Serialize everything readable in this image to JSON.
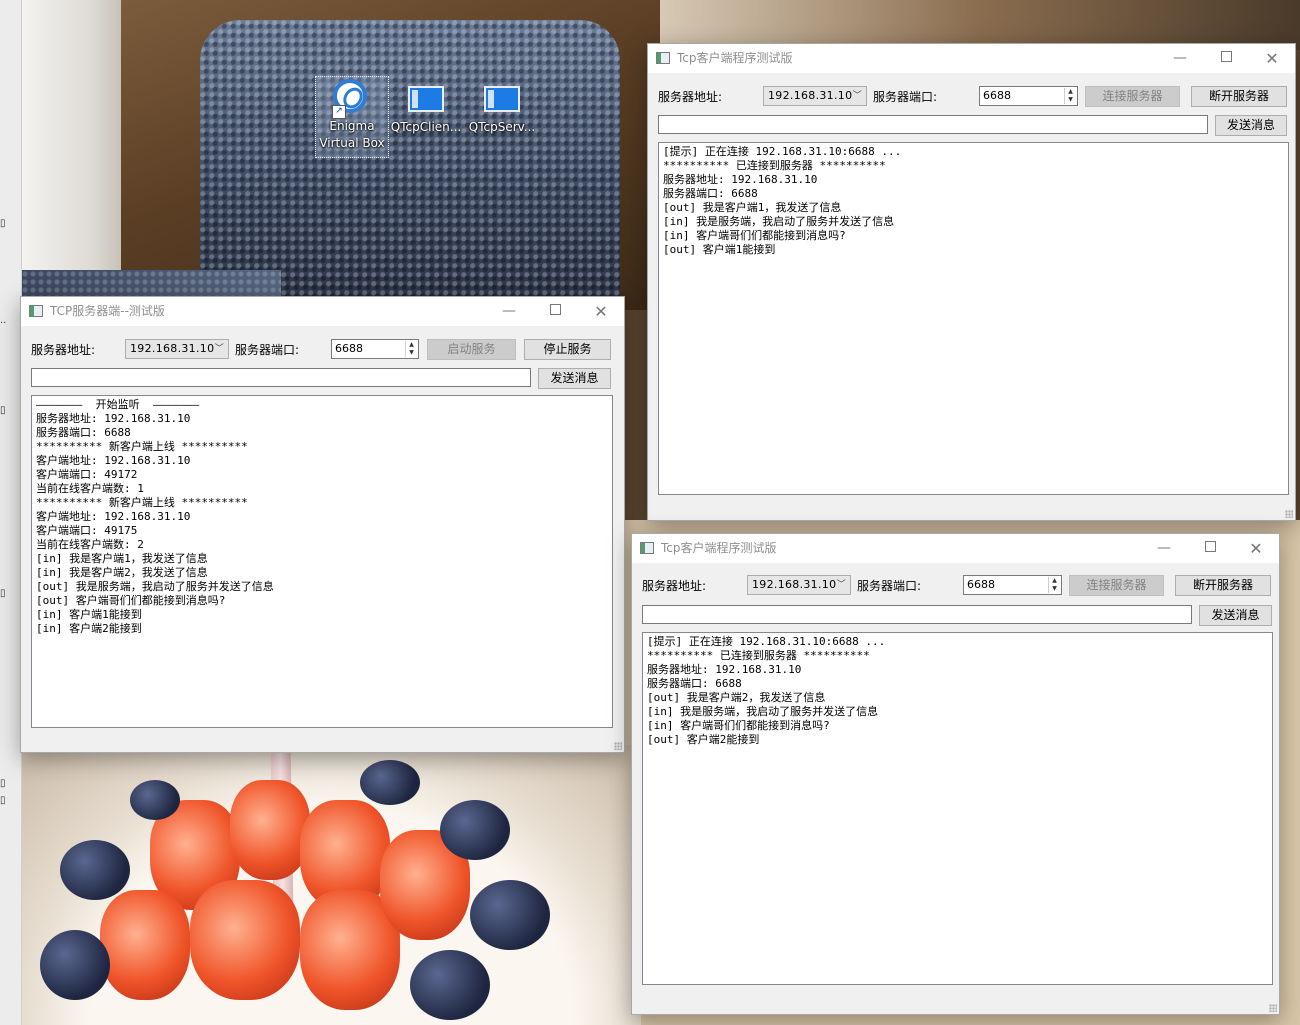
{
  "desktop": {
    "icons": [
      {
        "label_line1": "Enigma",
        "label_line2": "Virtual Box",
        "icon": "virtualbox-icon"
      },
      {
        "label": "QTcpClien...",
        "icon": "qt-app-icon"
      },
      {
        "label": "QTcpServ...",
        "icon": "qt-app-icon"
      }
    ]
  },
  "server_window": {
    "title": "TCP服务器端--测试版",
    "addr_label": "服务器地址:",
    "addr_value": "192.168.31.10",
    "port_label": "服务器端口:",
    "port_value": "6688",
    "start_button": "启动服务",
    "stop_button": "停止服务",
    "send_button": "发送消息",
    "message_value": "",
    "log": [
      "———————  开始监听  ———————",
      "服务器地址: 192.168.31.10",
      "服务器端口: 6688",
      "********** 新客户端上线 **********",
      "客户端地址: 192.168.31.10",
      "客户端端口: 49172",
      "当前在线客户端数: 1",
      "********** 新客户端上线 **********",
      "客户端地址: 192.168.31.10",
      "客户端端口: 49175",
      "当前在线客户端数: 2",
      "[in] 我是客户端1，我发送了信息",
      "[in] 我是客户端2，我发送了信息",
      "[out] 我是服务端，我启动了服务并发送了信息",
      "[out] 客户端哥们们都能接到消息吗?",
      "[in] 客户端1能接到",
      "[in] 客户端2能接到"
    ]
  },
  "client1_window": {
    "title": "Tcp客户端程序测试版",
    "addr_label": "服务器地址:",
    "addr_value": "192.168.31.10",
    "port_label": "服务器端口:",
    "port_value": "6688",
    "connect_button": "连接服务器",
    "disconnect_button": "断开服务器",
    "send_button": "发送消息",
    "message_value": "",
    "log": [
      "[提示] 正在连接 192.168.31.10:6688 ...",
      "********** 已连接到服务器 **********",
      "服务器地址: 192.168.31.10",
      "服务器端口: 6688",
      "[out] 我是客户端1，我发送了信息",
      "[in] 我是服务端，我启动了服务并发送了信息",
      "[in] 客户端哥们们都能接到消息吗?",
      "[out] 客户端1能接到"
    ]
  },
  "client2_window": {
    "title": "Tcp客户端程序测试版",
    "addr_label": "服务器地址:",
    "addr_value": "192.168.31.10",
    "port_label": "服务器端口:",
    "port_value": "6688",
    "connect_button": "连接服务器",
    "disconnect_button": "断开服务器",
    "send_button": "发送消息",
    "message_value": "",
    "log": [
      "[提示] 正在连接 192.168.31.10:6688 ...",
      "********** 已连接到服务器 **********",
      "服务器地址: 192.168.31.10",
      "服务器端口: 6688",
      "[out] 我是客户端2，我发送了信息",
      "[in] 我是服务端，我启动了服务并发送了信息",
      "[in] 客户端哥们们都能接到消息吗?",
      "[out] 客户端2能接到"
    ]
  },
  "window_controls": {
    "minimize": "—",
    "close": "✕"
  },
  "colors": {
    "disabled_button": "#cccccc",
    "window_bg": "#f0f0f0",
    "title_text": "#8f8f8f"
  }
}
